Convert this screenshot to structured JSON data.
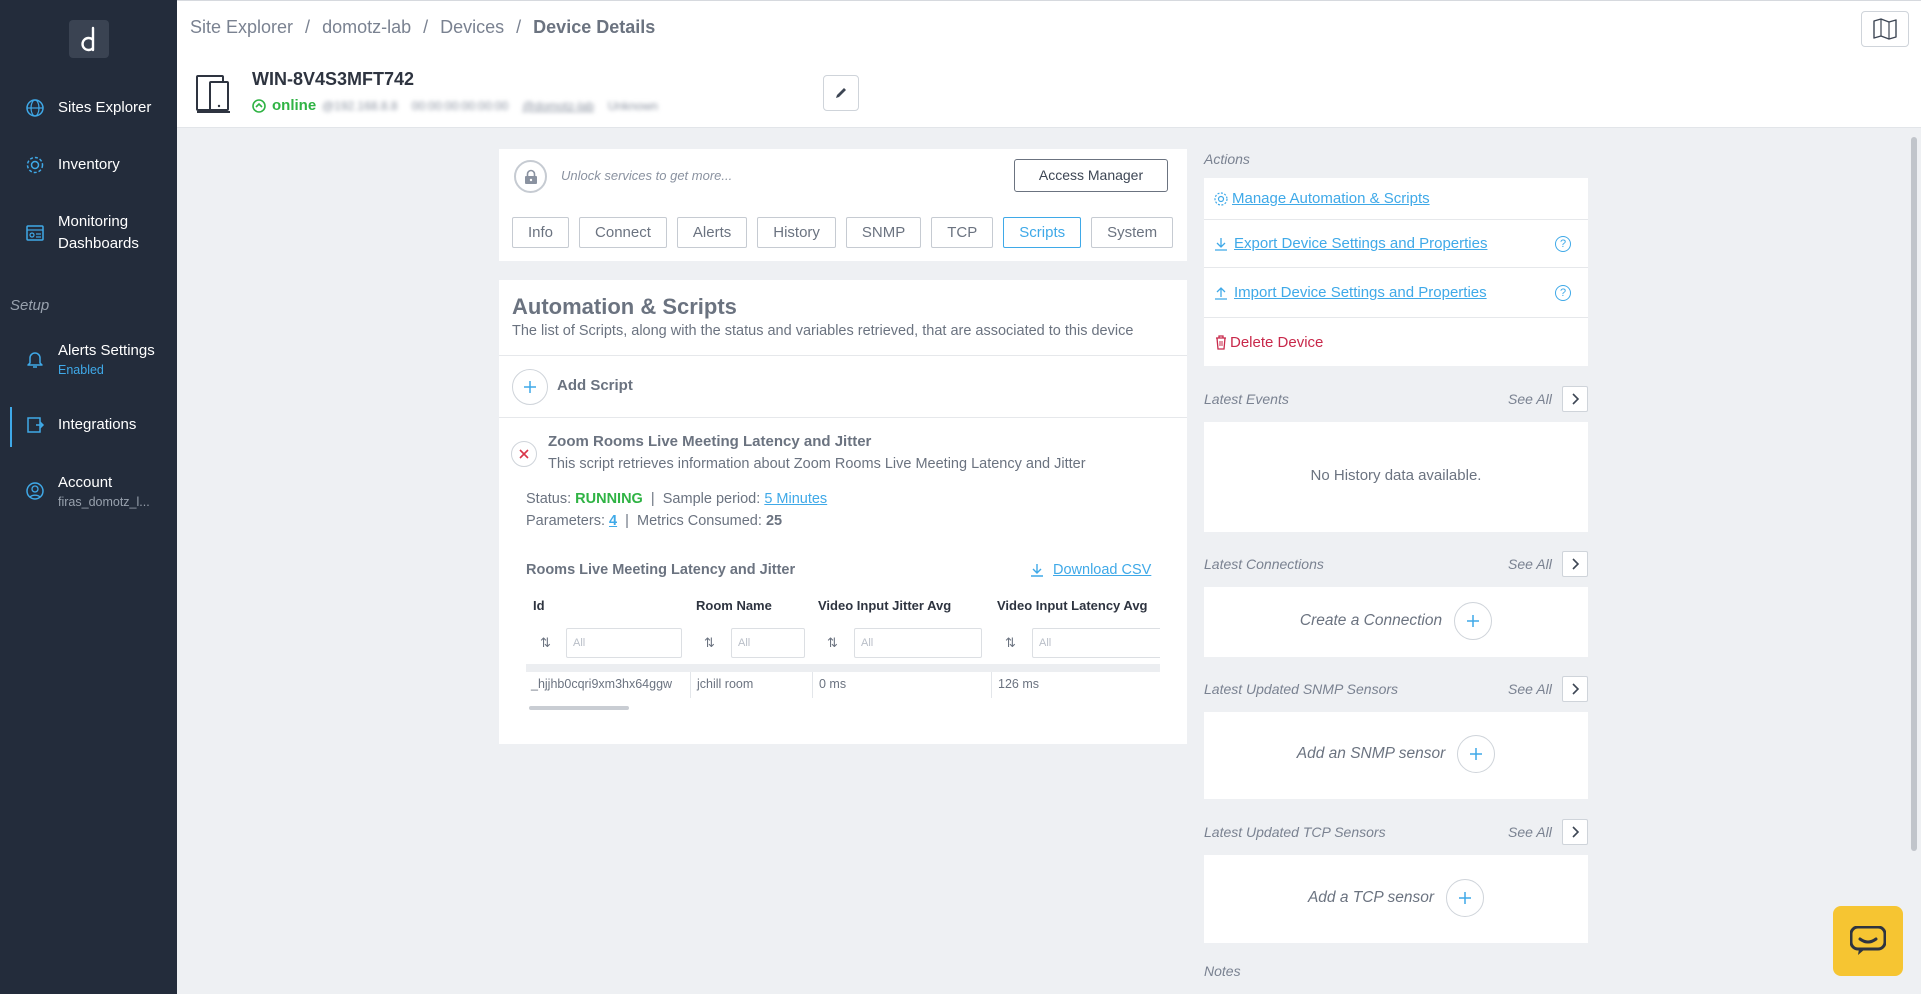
{
  "sidebar": {
    "items": [
      {
        "label": "Sites Explorer"
      },
      {
        "label": "Inventory"
      },
      {
        "label": "Monitoring",
        "label2": "Dashboards"
      },
      {
        "label": "Alerts Settings",
        "sub": "Enabled"
      },
      {
        "label": "Integrations"
      },
      {
        "label": "Account",
        "sub": "firas_domotz_l..."
      }
    ],
    "setup_label": "Setup"
  },
  "header": {
    "breadcrumb": [
      "Site Explorer",
      "domotz-lab",
      "Devices",
      "Device Details"
    ],
    "device_name": "WIN-8V4S3MFT742",
    "status": "online",
    "meta": [
      "@192.168.8.8",
      "00:00:00:00:00:00",
      "@domotz-lab",
      "Unknown"
    ]
  },
  "top_card": {
    "unlock_text": "Unlock services to get more...",
    "access_button": "Access Manager",
    "tabs": [
      "Info",
      "Connect",
      "Alerts",
      "History",
      "SNMP",
      "TCP",
      "Scripts",
      "System"
    ],
    "active_tab": "Scripts"
  },
  "scripts": {
    "title": "Automation & Scripts",
    "description": "The list of Scripts, along with the status and variables retrieved, that are associated to this device",
    "add_label": "Add Script",
    "script": {
      "title": "Zoom Rooms Live Meeting Latency and Jitter",
      "description": "This script retrieves information about Zoom Rooms Live Meeting Latency and Jitter",
      "status_label": "Status:",
      "status_value": "RUNNING",
      "sep": "|",
      "period_label": "Sample period:",
      "period_value": "5 Minutes",
      "params_label": "Parameters:",
      "params_value": "4",
      "metrics_label": "Metrics Consumed:",
      "metrics_value": "25"
    },
    "table": {
      "title": "Rooms Live Meeting Latency and Jitter",
      "download": "Download CSV",
      "filter_placeholder": "All",
      "columns": [
        "Id",
        "Room Name",
        "Video Input Jitter Avg",
        "Video Input Latency Avg"
      ],
      "rows": [
        [
          "_hjjhb0cqri9xm3hx64ggw",
          "jchill room",
          "0 ms",
          "126 ms"
        ]
      ]
    }
  },
  "right": {
    "actions_label": "Actions",
    "actions": [
      "Manage Automation & Scripts",
      "Export Device Settings and Properties",
      "Import Device Settings and Properties",
      "Delete Device"
    ],
    "see_all": "See All",
    "latest_events": {
      "label": "Latest Events",
      "empty": "No History data available."
    },
    "latest_connections": {
      "label": "Latest Connections",
      "create": "Create a Connection"
    },
    "snmp": {
      "label": "Latest Updated SNMP Sensors",
      "create": "Add an SNMP sensor"
    },
    "tcp": {
      "label": "Latest Updated TCP Sensors",
      "create": "Add a TCP sensor"
    },
    "notes_label": "Notes"
  },
  "colors": {
    "accent": "#3fa9e8",
    "sidebar": "#232c3b",
    "online": "#2fb344",
    "danger": "#c8284a",
    "chat": "#f6c532"
  }
}
